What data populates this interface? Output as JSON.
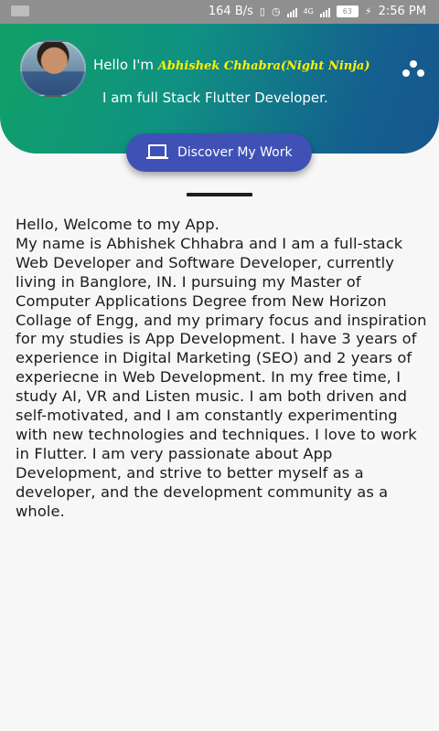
{
  "status_bar": {
    "left_indicator": "VoLTE",
    "network_speed": "164 B/s",
    "signal_label": "4G",
    "battery_level": "63",
    "time": "2:56 PM",
    "icons": [
      "vibrate-icon",
      "alarm-icon",
      "signal-icon",
      "battery-icon",
      "charging-icon"
    ]
  },
  "header": {
    "greeting_prefix": "Hello I'm ",
    "name": "Abhishek Chhabra(Night Ninja)",
    "subtitle": "I am full Stack Flutter Developer.",
    "menu_icon": "more-dots-icon",
    "name_color": "#fff200",
    "gradient_start": "#10a066",
    "gradient_end": "#17578e"
  },
  "discover_button": {
    "label": "Discover My Work",
    "icon": "laptop-icon",
    "color": "#3f51b5"
  },
  "about": {
    "text": "Hello, Welcome to my App.\nMy name is Abhishek Chhabra and I am a full-stack Web Developer and Software Developer, currently living in Banglore, IN. I pursuing my Master of Computer Applications Degree from New Horizon Collage of Engg, and my primary focus and inspiration for my studies is App Development. I have 3 years of experience in Digital Marketing (SEO) and 2 years of experiecne in Web Development. In my free time, I study AI, VR and Listen music. I am both driven and self-motivated, and I am constantly experimenting with new technologies and techniques. I love to work in Flutter. I am very passionate about App Development, and strive to better myself as a developer, and the development community as a whole."
  }
}
